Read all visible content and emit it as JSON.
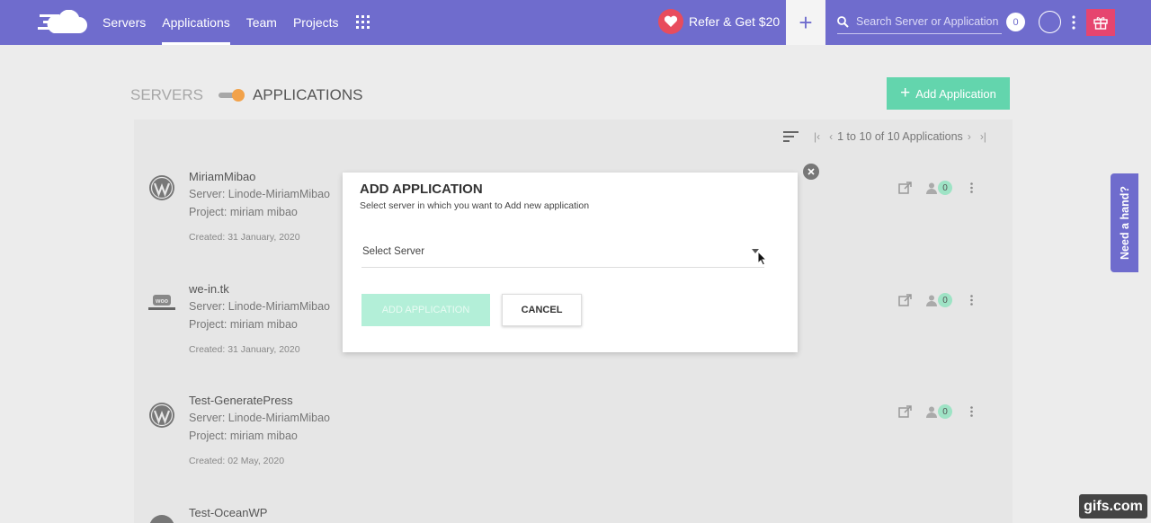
{
  "nav": {
    "items": [
      {
        "label": "Servers",
        "active": false
      },
      {
        "label": "Applications",
        "active": true
      },
      {
        "label": "Team",
        "active": false
      },
      {
        "label": "Projects",
        "active": false
      }
    ],
    "refer_label": "Refer & Get $20",
    "search_placeholder": "Search Server or Application",
    "notification_count": "0"
  },
  "header": {
    "servers_label": "SERVERS",
    "applications_label": "APPLICATIONS",
    "add_application_label": "Add Application"
  },
  "pager": {
    "text": "1 to 10 of 10 Applications"
  },
  "applications": [
    {
      "name": "MiriamMibao",
      "server": "Server: Linode-MiriamMibao",
      "project": "Project: miriam mibao",
      "created": "Created: 31 January, 2020",
      "logo": "wordpress",
      "count": "0"
    },
    {
      "name": "we-in.tk",
      "server": "Server: Linode-MiriamMibao",
      "project": "Project: miriam mibao",
      "created": "Created: 31 January, 2020",
      "logo": "woocommerce",
      "count": "0"
    },
    {
      "name": "Test-GeneratePress",
      "server": "Server: Linode-MiriamMibao",
      "project": "Project: miriam mibao",
      "created": "Created: 02 May, 2020",
      "logo": "wordpress",
      "count": "0"
    },
    {
      "name": "Test-OceanWP",
      "logo": "wordpress"
    }
  ],
  "modal": {
    "title": "ADD APPLICATION",
    "subtitle": "Select server in which you want to Add new application",
    "select_label": "Select Server",
    "add_button": "ADD APPLICATION",
    "cancel_button": "CANCEL"
  },
  "side_tab": "Need a hand?",
  "watermark": "gifs.com",
  "colors": {
    "nav_bg": "#6f6ccd",
    "accent_green": "#63d5ad",
    "heart": "#e84c5d",
    "gift": "#e6456f",
    "toggle_knob": "#f2a24a"
  },
  "icons": [
    "cloud-logo-icon",
    "apps-grid-icon",
    "heart-icon",
    "plus-icon",
    "search-icon",
    "avatar-icon",
    "kebab-icon",
    "gift-icon",
    "sort-icon",
    "first-page-icon",
    "prev-page-icon",
    "next-page-icon",
    "last-page-icon",
    "wordpress-icon",
    "woocommerce-icon",
    "external-link-icon",
    "user-icon",
    "close-icon",
    "caret-down-icon",
    "mouse-cursor-icon"
  ]
}
